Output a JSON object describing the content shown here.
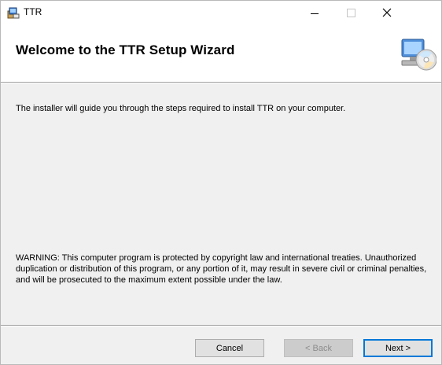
{
  "window": {
    "title": "TTR",
    "controls": {
      "minimize_icon": "minimize-icon",
      "maximize_icon": "maximize-icon",
      "close_label": "✕"
    }
  },
  "banner": {
    "title": "Welcome to the TTR Setup Wizard",
    "icon": "computer-cd-icon"
  },
  "content": {
    "intro": "The installer will guide you through the steps required to install TTR on your computer.",
    "warning": "WARNING: This computer program is protected by copyright law and international treaties. Unauthorized duplication or distribution of this program, or any portion of it, may result in severe civil or criminal penalties, and will be prosecuted to the maximum extent possible under the law."
  },
  "buttons": {
    "cancel": "Cancel",
    "back": "< Back",
    "next": "Next >"
  },
  "colors": {
    "accent": "#0078d7",
    "dialog_bg": "#f0f0f0",
    "banner_bg": "#ffffff"
  }
}
